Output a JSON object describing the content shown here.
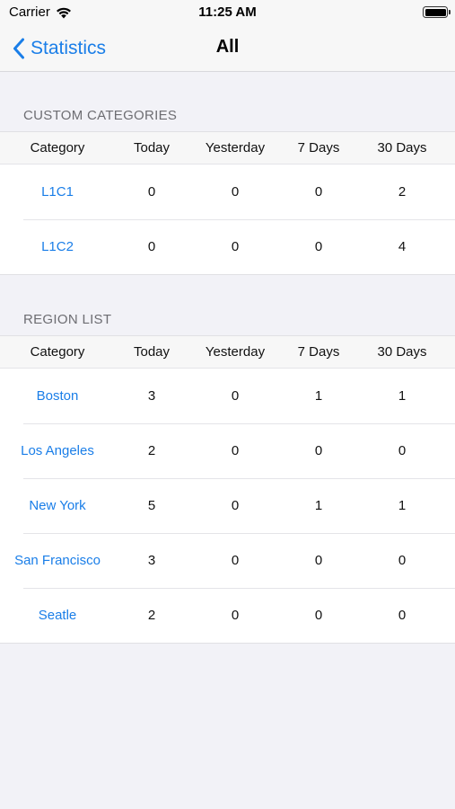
{
  "status_bar": {
    "carrier": "Carrier",
    "time": "11:25 AM"
  },
  "nav": {
    "back_label": "Statistics",
    "title": "All"
  },
  "columns": [
    "Category",
    "Today",
    "Yesterday",
    "7 Days",
    "30 Days"
  ],
  "sections": [
    {
      "header": "CUSTOM CATEGORIES",
      "rows": [
        {
          "name": "L1C1",
          "today": "0",
          "yesterday": "0",
          "days7": "0",
          "days30": "2"
        },
        {
          "name": "L1C2",
          "today": "0",
          "yesterday": "0",
          "days7": "0",
          "days30": "4"
        }
      ]
    },
    {
      "header": "REGION LIST",
      "rows": [
        {
          "name": "Boston",
          "today": "3",
          "yesterday": "0",
          "days7": "1",
          "days30": "1"
        },
        {
          "name": "Los Angeles",
          "today": "2",
          "yesterday": "0",
          "days7": "0",
          "days30": "0"
        },
        {
          "name": "New York",
          "today": "5",
          "yesterday": "0",
          "days7": "1",
          "days30": "1"
        },
        {
          "name": "San Francisco",
          "today": "3",
          "yesterday": "0",
          "days7": "0",
          "days30": "0"
        },
        {
          "name": "Seatle",
          "today": "2",
          "yesterday": "0",
          "days7": "0",
          "days30": "0"
        }
      ]
    }
  ],
  "colors": {
    "accent": "#1a7ee8",
    "background": "#f2f2f7"
  },
  "icons": {
    "wifi": "wifi-icon",
    "battery": "battery-icon",
    "back": "chevron-left-icon"
  }
}
